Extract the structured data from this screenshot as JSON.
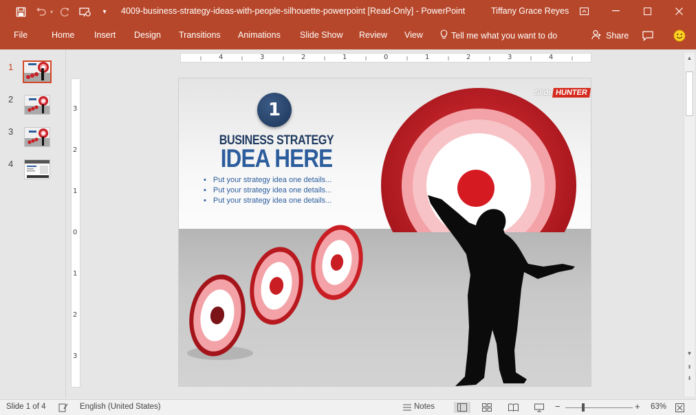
{
  "window": {
    "document_title": "4009-business-strategy-ideas-with-people-silhouette-powerpoint [Read-Only]  -  PowerPoint",
    "user": "Tiffany Grace Reyes"
  },
  "quick_access": {
    "icons": [
      "save-icon",
      "undo-icon",
      "redo-icon",
      "slideshow-from-start-icon",
      "customize-toolbar-icon"
    ]
  },
  "ribbon": {
    "tabs": [
      "File",
      "Home",
      "Insert",
      "Design",
      "Transitions",
      "Animations",
      "Slide Show",
      "Review",
      "View"
    ],
    "tell_me": "Tell me what you want to do",
    "share": "Share"
  },
  "thumbnails": {
    "numbers": [
      "1",
      "2",
      "3",
      "4"
    ],
    "active_index": 0
  },
  "rulers": {
    "horizontal": [
      "4",
      "3",
      "2",
      "1",
      "0",
      "1",
      "2",
      "3",
      "4"
    ],
    "vertical": [
      "3",
      "2",
      "1",
      "0",
      "1",
      "2",
      "3"
    ]
  },
  "slide": {
    "number_badge": "1",
    "heading_line1": "BUSINESS STRATEGY",
    "heading_line2": "IDEA HERE",
    "bullets": [
      "Put your strategy idea one details...",
      "Put your strategy idea one details...",
      "Put your strategy idea one details..."
    ],
    "brand_part1": "Slide",
    "brand_part2": "HUNTER",
    "colors": {
      "target_red": "#c81e24",
      "target_pink": "#f3a3a8",
      "heading_dark": "#1f3a5f",
      "heading_blue": "#2b5c9c"
    }
  },
  "statusbar": {
    "slide_info": "Slide 1 of 4",
    "language": "English (United States)",
    "notes": "Notes",
    "zoom": "63%"
  },
  "colors": {
    "accent": "#b7472a",
    "active_thumb_border": "#d24726"
  }
}
